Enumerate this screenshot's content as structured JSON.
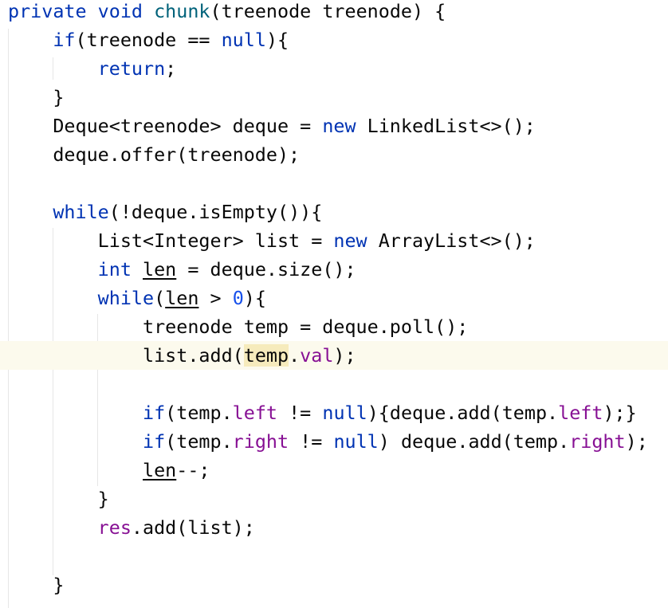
{
  "editor": {
    "highlight_color": "#fcfaed",
    "colors": {
      "keyword": "#0033b3",
      "method_decl": "#00627a",
      "field": "#871094",
      "number": "#1750eb",
      "text": "#080808"
    },
    "lines": [
      {
        "current": false,
        "tokens": [
          {
            "t": "private void ",
            "c": "kw"
          },
          {
            "t": "chunk",
            "c": "fn"
          },
          {
            "t": "(treenode treenode) {"
          }
        ]
      },
      {
        "current": false,
        "tokens": [
          {
            "t": "    "
          },
          {
            "t": "if",
            "c": "kw"
          },
          {
            "t": "(treenode == "
          },
          {
            "t": "null",
            "c": "kw"
          },
          {
            "t": "){"
          }
        ]
      },
      {
        "current": false,
        "tokens": [
          {
            "t": "        "
          },
          {
            "t": "return",
            "c": "kw"
          },
          {
            "t": ";"
          }
        ]
      },
      {
        "current": false,
        "tokens": [
          {
            "t": "    }"
          }
        ]
      },
      {
        "current": false,
        "tokens": [
          {
            "t": "    Deque<treenode> deque = "
          },
          {
            "t": "new",
            "c": "kw"
          },
          {
            "t": " LinkedList<>();"
          }
        ]
      },
      {
        "current": false,
        "tokens": [
          {
            "t": "    deque.offer(treenode);"
          }
        ]
      },
      {
        "current": false,
        "tokens": []
      },
      {
        "current": false,
        "tokens": [
          {
            "t": "    "
          },
          {
            "t": "while",
            "c": "kw"
          },
          {
            "t": "(!deque.isEmpty()){"
          }
        ]
      },
      {
        "current": false,
        "tokens": [
          {
            "t": "        List<Integer> list = "
          },
          {
            "t": "new",
            "c": "kw"
          },
          {
            "t": " ArrayList<>();"
          }
        ]
      },
      {
        "current": false,
        "tokens": [
          {
            "t": "        "
          },
          {
            "t": "int",
            "c": "kw"
          },
          {
            "t": " "
          },
          {
            "t": "len",
            "c": "und"
          },
          {
            "t": " = deque.size();"
          }
        ]
      },
      {
        "current": false,
        "tokens": [
          {
            "t": "        "
          },
          {
            "t": "while",
            "c": "kw"
          },
          {
            "t": "("
          },
          {
            "t": "len",
            "c": "und"
          },
          {
            "t": " > "
          },
          {
            "t": "0",
            "c": "num"
          },
          {
            "t": "){"
          }
        ]
      },
      {
        "current": false,
        "tokens": [
          {
            "t": "            treenode temp = deque.poll();"
          }
        ]
      },
      {
        "current": true,
        "tokens": [
          {
            "t": "            list.add("
          },
          {
            "t": "temp",
            "c": "hl"
          },
          {
            "t": "."
          },
          {
            "t": "val",
            "c": "fld"
          },
          {
            "t": ");"
          }
        ]
      },
      {
        "current": false,
        "tokens": []
      },
      {
        "current": false,
        "tokens": [
          {
            "t": "            "
          },
          {
            "t": "if",
            "c": "kw"
          },
          {
            "t": "(temp."
          },
          {
            "t": "left",
            "c": "fld"
          },
          {
            "t": " != "
          },
          {
            "t": "null",
            "c": "kw"
          },
          {
            "t": "){deque.add(temp."
          },
          {
            "t": "left",
            "c": "fld"
          },
          {
            "t": ");}"
          }
        ]
      },
      {
        "current": false,
        "tokens": [
          {
            "t": "            "
          },
          {
            "t": "if",
            "c": "kw"
          },
          {
            "t": "(temp."
          },
          {
            "t": "right",
            "c": "fld"
          },
          {
            "t": " != "
          },
          {
            "t": "null",
            "c": "kw"
          },
          {
            "t": ") deque.add(temp."
          },
          {
            "t": "right",
            "c": "fld"
          },
          {
            "t": ");"
          }
        ]
      },
      {
        "current": false,
        "tokens": [
          {
            "t": "            "
          },
          {
            "t": "len",
            "c": "und"
          },
          {
            "t": "--;"
          }
        ]
      },
      {
        "current": false,
        "tokens": [
          {
            "t": "        }"
          }
        ]
      },
      {
        "current": false,
        "tokens": [
          {
            "t": "        "
          },
          {
            "t": "res",
            "c": "fld"
          },
          {
            "t": ".add(list);"
          }
        ]
      },
      {
        "current": false,
        "tokens": []
      },
      {
        "current": false,
        "tokens": [
          {
            "t": "    }"
          }
        ]
      }
    ]
  }
}
